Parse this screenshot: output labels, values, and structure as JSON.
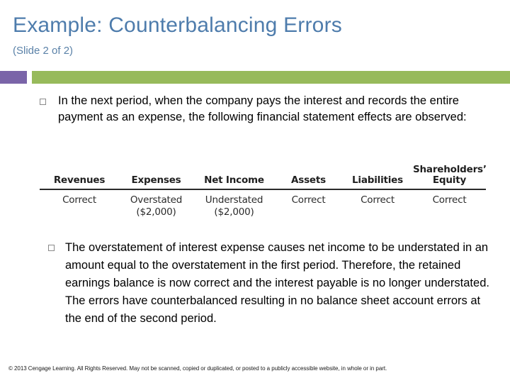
{
  "slide": {
    "title": "Example: Counterbalancing Errors",
    "subtitle": "(Slide 2 of 2)",
    "title_color": "#4E7CAC",
    "accent_purple": "#7A64A8",
    "accent_green": "#97BA5B"
  },
  "bullets": [
    {
      "marker": "open-square-bullet",
      "text": "In the next period, when the company pays the interest and records the entire payment as an expense, the following financial statement effects are observed:"
    },
    {
      "marker": "open-square-bullet",
      "text": "The overstatement of interest expense causes net income to be understated in an amount equal to the overstatement in the first period. Therefore, the retained earnings balance is now correct and the interest payable is no longer understated. The errors have counterbalanced resulting in no balance sheet account errors at the end of the second period."
    }
  ],
  "table": {
    "headers": [
      "Revenues",
      "Expenses",
      "Net Income",
      "Assets",
      "Liabilities",
      "Shareholders’ Equity"
    ],
    "header_lines": [
      [
        "Revenues"
      ],
      [
        "Expenses"
      ],
      [
        "Net Income"
      ],
      [
        "Assets"
      ],
      [
        "Liabilities"
      ],
      [
        "Shareholders’",
        "Equity"
      ]
    ],
    "rows": [
      {
        "cells": [
          {
            "line1": "Correct",
            "line2": ""
          },
          {
            "line1": "Overstated",
            "line2": "($2,000)"
          },
          {
            "line1": "Understated",
            "line2": "($2,000)"
          },
          {
            "line1": "Correct",
            "line2": ""
          },
          {
            "line1": "Correct",
            "line2": ""
          },
          {
            "line1": "Correct",
            "line2": ""
          }
        ]
      }
    ]
  },
  "footer": {
    "copyright": "© 2013 Cengage Learning. All Rights Reserved. May not be scanned, copied or duplicated, or posted to a publicly accessible website, in whole or in part."
  }
}
